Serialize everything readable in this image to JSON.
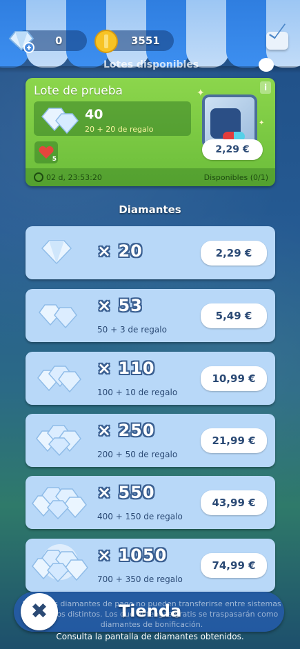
{
  "header": {
    "diamonds_value": "0",
    "coins_value": "3551",
    "subtitle": "Lotes disponibles"
  },
  "trial_pack": {
    "title": "Lote de prueba",
    "quantity": "40",
    "bonus": "20 + 20 de regalo",
    "heart_count": "5",
    "price": "2,29 €",
    "timer": "02 d, 23:53:20",
    "availability": "Disponibles (0/1)",
    "info": "i"
  },
  "section": {
    "title": "Diamantes"
  },
  "diamond_packs": [
    {
      "quantity": "× 20",
      "bonus": "",
      "price": "2,29 €"
    },
    {
      "quantity": "× 53",
      "bonus": "50 + 3 de regalo",
      "price": "5,49 €"
    },
    {
      "quantity": "× 110",
      "bonus": "100 + 10 de regalo",
      "price": "10,99 €"
    },
    {
      "quantity": "× 250",
      "bonus": "200 + 50 de regalo",
      "price": "21,99 €"
    },
    {
      "quantity": "× 550",
      "bonus": "400 + 150 de regalo",
      "price": "43,99 €"
    },
    {
      "quantity": "× 1050",
      "bonus": "700 + 350 de regalo",
      "price": "74,99 €"
    }
  ],
  "footer": {
    "notice": "Nota: Los diamantes de pago no pueden transferirse entre sistemas operativos distintos. Los que obtengas gratis se traspasarán como diamantes de bonificación.",
    "title": "Tienda",
    "consult": "Consulta la pantalla de diamantes obtenidos."
  },
  "colors": {
    "price_text": "#2b4a75",
    "row_bg": "#b8d8f8",
    "trial_bg": "#7ccb44"
  },
  "icons": [
    "diamond-plus-icon",
    "coin-icon",
    "mail-icon",
    "info-icon",
    "heart-icon",
    "clock-icon",
    "gift-cube-icon",
    "diamond-icon",
    "close-icon"
  ]
}
